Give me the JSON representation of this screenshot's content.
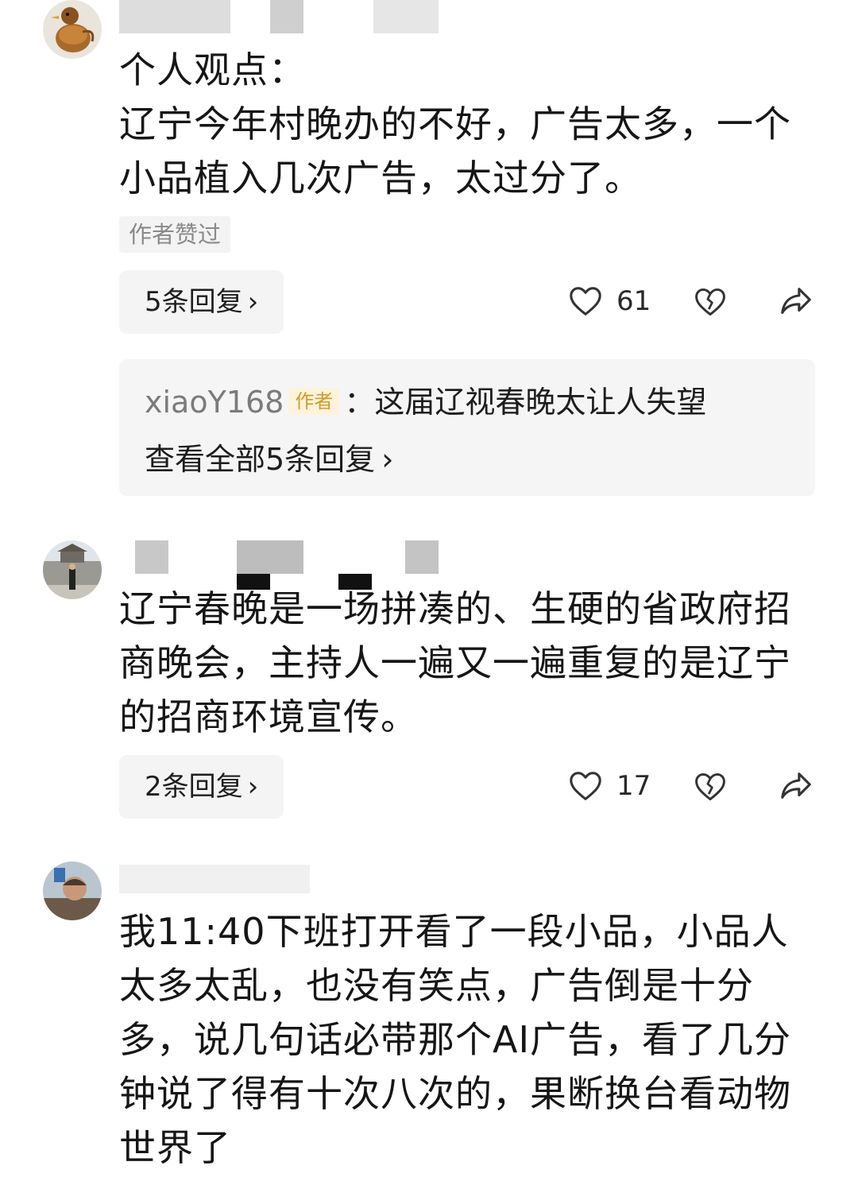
{
  "comments": [
    {
      "avatar": "avatar-duck-icon",
      "content": "个人观点：\n辽宁今年村晚办的不好，广告太多，一个\n小品植入几次广告，太过分了。",
      "author_liked": "作者赞过",
      "reply_count_label": "5条回复",
      "like_count": "61",
      "reply_preview": {
        "user": "xiaoY168",
        "author_tag": "作者",
        "separator": "：",
        "text": "这届辽视春晚太让人失望",
        "view_all": "查看全部5条回复"
      }
    },
    {
      "avatar": "avatar-building-icon",
      "content": "辽宁春晚是一场拼凑的、生硬的省政府招\n商晚会，主持人一遍又一遍重复的是辽宁\n的招商环境宣传。",
      "reply_count_label": "2条回复",
      "like_count": "17"
    },
    {
      "avatar": "avatar-person-icon",
      "content": "我11:40下班打开看了一段小品，小品人\n太多太乱，也没有笑点，广告倒是十分\n多，说几句话必带那个AI广告，看了几分\n钟说了得有十次八次的，果断换台看动物\n世界了"
    }
  ],
  "chevron": "›"
}
